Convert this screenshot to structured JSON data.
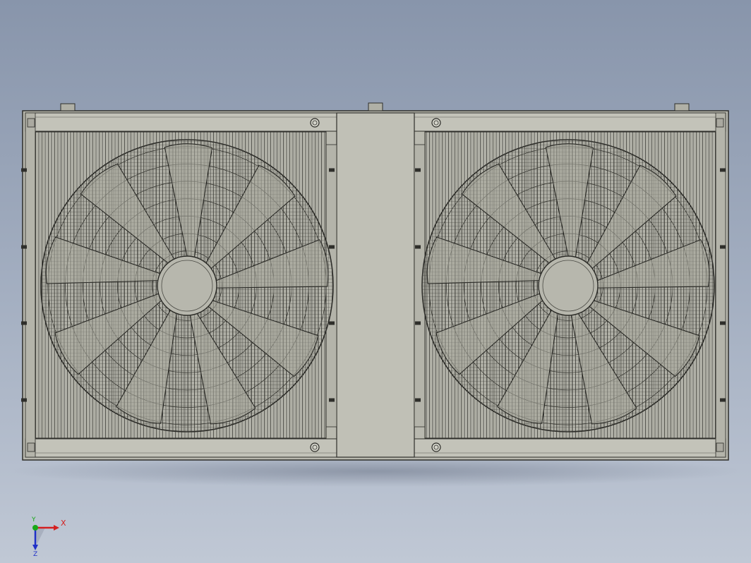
{
  "view": {
    "background_top": "#8895ab",
    "background_bottom": "#c0c8d5",
    "part_color": "#bdbdb3",
    "edge_color": "#2e2e2a",
    "shadow_color": "#7d8798"
  },
  "model": {
    "fans": [
      {
        "name": "left-fan",
        "blade_count": 9
      },
      {
        "name": "right-fan",
        "blade_count": 9
      }
    ],
    "mount_holes_per_fan": 2
  },
  "triad": {
    "x_label": "X",
    "y_label": "Y",
    "z_label": "Z",
    "x_color": "#d42020",
    "y_color": "#18a818",
    "z_color": "#2030c8"
  }
}
